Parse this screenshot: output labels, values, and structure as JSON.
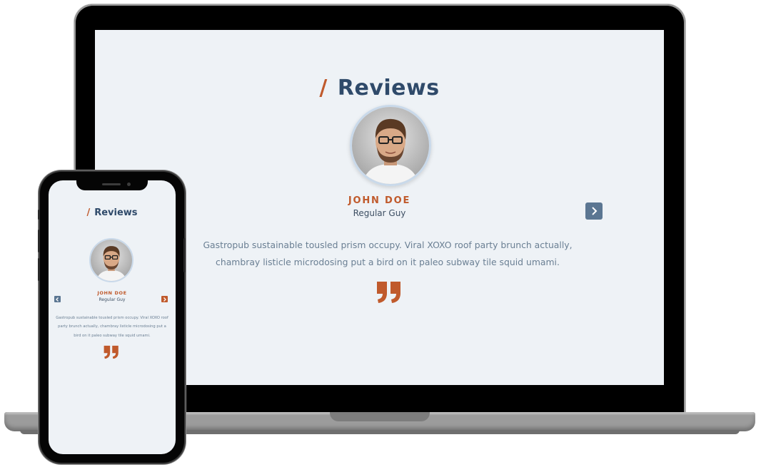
{
  "section": {
    "slash": "/",
    "title": "Reviews"
  },
  "review": {
    "name": "JOHN DOE",
    "role": "Regular Guy",
    "text": "Gastropub sustainable tousled prism occupy. Viral XOXO roof party brunch actually, chambray listicle microdosing put a bird on it paleo subway tile squid umami."
  },
  "icons": {
    "prev": "chevron-left-icon",
    "next": "chevron-right-icon",
    "quote": "quote-icon"
  },
  "colors": {
    "accent": "#c05a2c",
    "heading": "#2f4a6a",
    "button": "#5b7692",
    "screen_bg": "#eef2f6",
    "body_text": "#6a7f93"
  }
}
